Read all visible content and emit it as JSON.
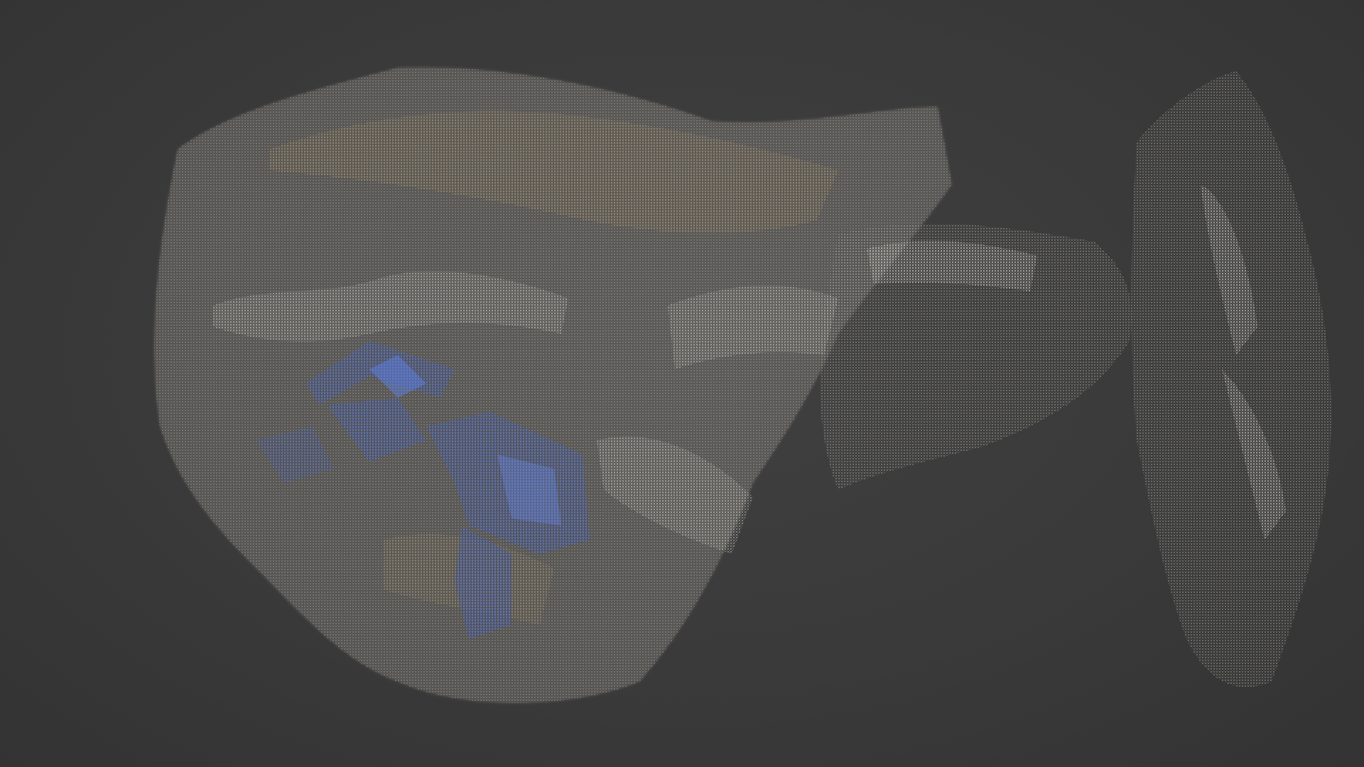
{
  "viewport": {
    "background": "#3b3b3b",
    "content": "point-cloud-scan"
  },
  "colors": {
    "rock_light": "#d8d8d2",
    "rock_mid": "#9a9690",
    "rock_dark": "#4a4844",
    "sand": "#a8906a",
    "highlight_blue": "#3f63d8"
  }
}
